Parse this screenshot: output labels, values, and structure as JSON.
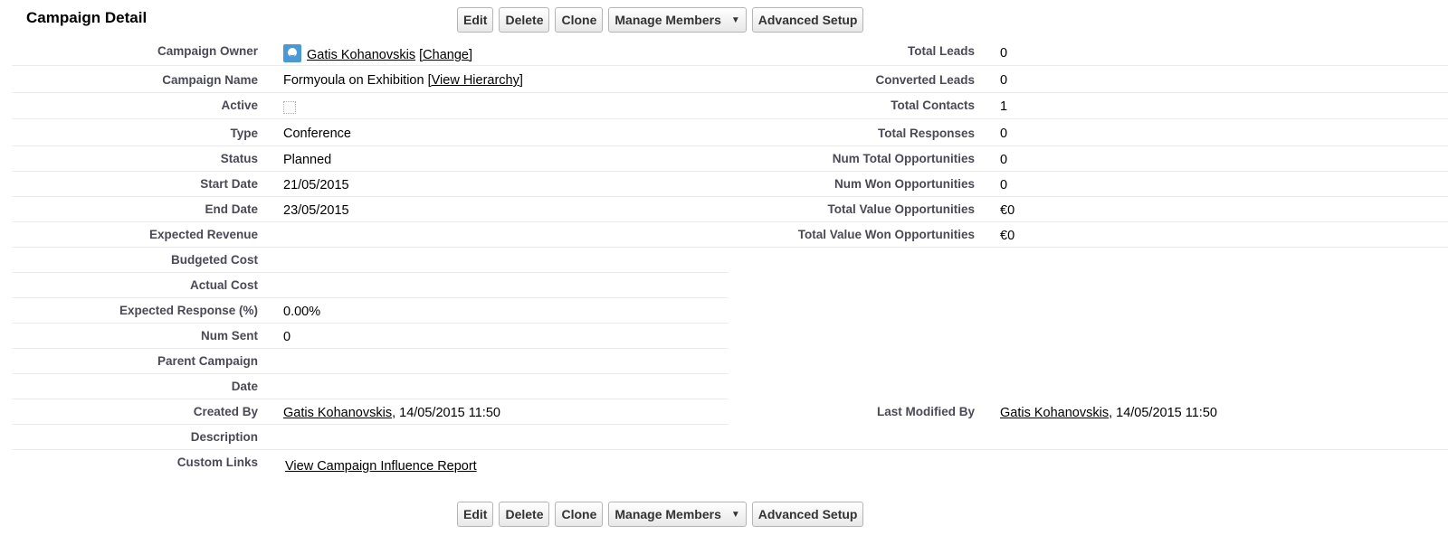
{
  "page": {
    "title": "Campaign Detail"
  },
  "buttons": {
    "edit": "Edit",
    "delete": "Delete",
    "clone": "Clone",
    "manage_members": "Manage Members",
    "advanced_setup": "Advanced Setup"
  },
  "left": {
    "campaign_owner": {
      "label": "Campaign Owner",
      "name": "Gatis Kohanovskis",
      "change": "[Change]"
    },
    "campaign_name": {
      "label": "Campaign Name",
      "value": "Formyoula on Exhibition",
      "view_hierarchy": "[View Hierarchy]"
    },
    "active": {
      "label": "Active",
      "checked": false
    },
    "type": {
      "label": "Type",
      "value": "Conference"
    },
    "status": {
      "label": "Status",
      "value": "Planned"
    },
    "start_date": {
      "label": "Start Date",
      "value": "21/05/2015"
    },
    "end_date": {
      "label": "End Date",
      "value": "23/05/2015"
    },
    "expected_revenue": {
      "label": "Expected Revenue",
      "value": ""
    },
    "budgeted_cost": {
      "label": "Budgeted Cost",
      "value": ""
    },
    "actual_cost": {
      "label": "Actual Cost",
      "value": ""
    },
    "expected_response": {
      "label": "Expected Response (%)",
      "value": "0.00%"
    },
    "num_sent": {
      "label": "Num Sent",
      "value": "0"
    },
    "parent_campaign": {
      "label": "Parent Campaign",
      "value": ""
    },
    "date": {
      "label": "Date",
      "value": ""
    },
    "created_by": {
      "label": "Created By",
      "name": "Gatis Kohanovskis",
      "timestamp": ", 14/05/2015 11:50"
    },
    "description": {
      "label": "Description",
      "value": ""
    },
    "custom_links": {
      "label": "Custom Links",
      "link": "View Campaign Influence Report"
    }
  },
  "right": {
    "total_leads": {
      "label": "Total Leads",
      "value": "0"
    },
    "converted_leads": {
      "label": "Converted Leads",
      "value": "0"
    },
    "total_contacts": {
      "label": "Total Contacts",
      "value": "1"
    },
    "total_responses": {
      "label": "Total Responses",
      "value": "0"
    },
    "num_total_opps": {
      "label": "Num Total Opportunities",
      "value": "0"
    },
    "num_won_opps": {
      "label": "Num Won Opportunities",
      "value": "0"
    },
    "total_value_opps": {
      "label": "Total Value Opportunities",
      "value": "€0"
    },
    "total_value_won_opps": {
      "label": "Total Value Won Opportunities",
      "value": "€0"
    },
    "last_modified_by": {
      "label": "Last Modified By",
      "name": "Gatis Kohanovskis",
      "timestamp": ", 14/05/2015 11:50"
    }
  },
  "icons": {
    "owner_avatar": "user-avatar-icon",
    "dropdown": "chevron-down-icon"
  }
}
